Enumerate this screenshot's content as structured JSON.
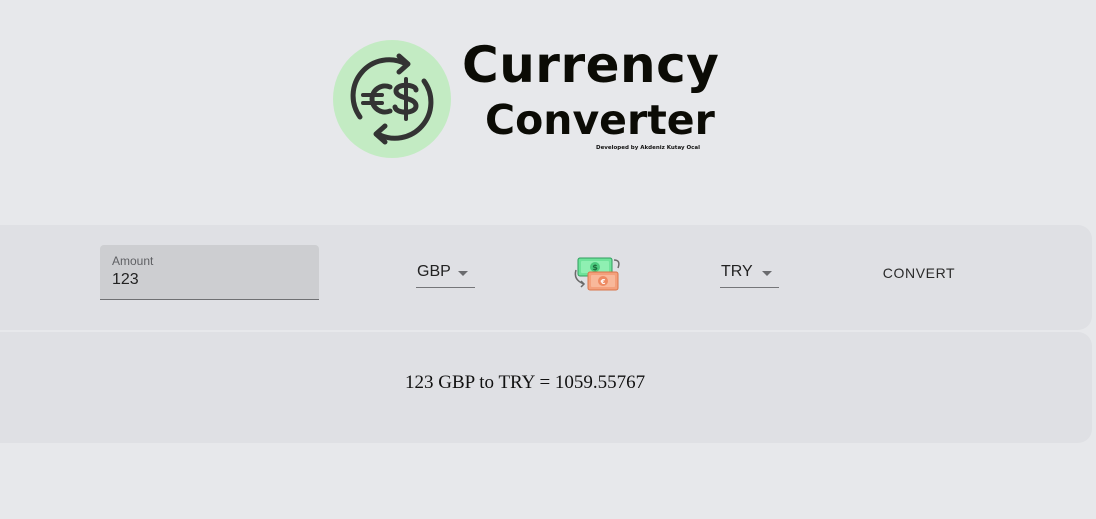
{
  "header": {
    "title_line1": "Currency",
    "title_line2": "Converter",
    "credit": "Developed by Akdeniz Kutay Ocal",
    "logo_icon": "currency-exchange-icon",
    "logo_color": "#c3ebc3"
  },
  "converter": {
    "amount_label": "Amount",
    "amount_value": "123",
    "from_currency": "GBP",
    "to_currency": "TRY",
    "swap_icon": "money-swap-icon",
    "convert_label": "CONVERT"
  },
  "result": {
    "text": "123 GBP to TRY = 1059.55767"
  }
}
